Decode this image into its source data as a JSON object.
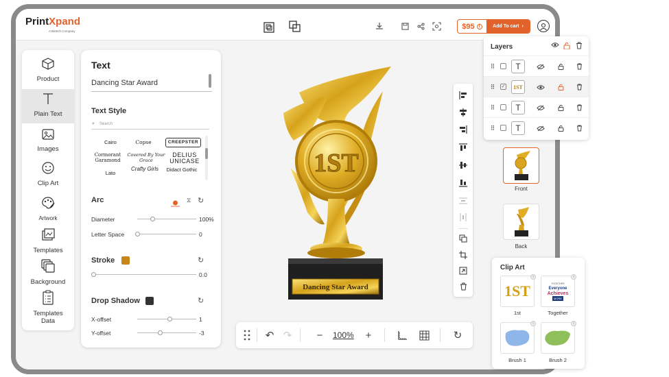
{
  "brand": {
    "name_part1": "Print",
    "name_part2": "Xpand",
    "tagline": "A Birtech Company"
  },
  "header": {
    "price": "$95",
    "add_to_cart": "Add To cart"
  },
  "sidebar": {
    "items": [
      {
        "label": "Product",
        "icon": "cube-icon"
      },
      {
        "label": "Plain Text",
        "icon": "text-t-icon"
      },
      {
        "label": "Images",
        "icon": "image-icon"
      },
      {
        "label": "Clip Art",
        "icon": "smiley-icon"
      },
      {
        "label": "Artwork",
        "icon": "palette-icon"
      },
      {
        "label": "Templates",
        "icon": "templates-icon"
      },
      {
        "label": "Background",
        "icon": "background-layers-icon"
      },
      {
        "label": "Templates Data",
        "icon": "clipboard-list-icon"
      }
    ],
    "active": "Plain Text"
  },
  "text_panel": {
    "title": "Text",
    "text_value": "Dancing Star Award",
    "text_style_heading": "Text Style",
    "search_placeholder": "Search",
    "fonts": [
      "Cairo",
      "Copse",
      "CREEPSTER",
      "Cormorant Garamond",
      "Covered By Your Grace",
      "DELIUS UNICASE",
      "Lato",
      "Crafty Girls",
      "Didact Gothic"
    ],
    "selected_font": "CREEPSTER",
    "arc": {
      "heading": "Arc",
      "diameter_label": "Diameter",
      "diameter_value": "100%",
      "letter_space_label": "Letter Space",
      "letter_space_value": "0"
    },
    "stroke": {
      "heading": "Stroke",
      "color": "#c8861a",
      "value": "0.0"
    },
    "drop_shadow": {
      "heading": "Drop Shadow",
      "color": "#333333",
      "x_offset_label": "X-offset",
      "x_offset_value": "1",
      "y_offset_label": "Y-offset",
      "y_offset_value": "-3"
    }
  },
  "stage": {
    "trophy_text": "1ST",
    "plaque_text": "Dancing Star Award"
  },
  "bottom_toolbar": {
    "zoom": "100%"
  },
  "layers": {
    "title": "Layers",
    "rows": [
      {
        "thumb": "T",
        "type": "text",
        "selected": false,
        "locked": false
      },
      {
        "thumb": "1ST",
        "type": "image",
        "selected": true,
        "locked": true
      },
      {
        "thumb": "T",
        "type": "text",
        "selected": false,
        "locked": false
      },
      {
        "thumb": "T",
        "type": "text",
        "selected": false,
        "locked": false
      }
    ]
  },
  "views": [
    {
      "label": "Front"
    },
    {
      "label": "Back"
    }
  ],
  "clip_art": {
    "title": "Clip Art",
    "items": [
      {
        "label": "1st",
        "text": "1ST"
      },
      {
        "label": "Together",
        "text_line1": "TOGETHER",
        "text_line2": "Everyone",
        "text_line3": "Achieves",
        "text_line4": "MORE"
      },
      {
        "label": "Brush 1",
        "color": "#8fb6e8"
      },
      {
        "label": "Brush 2",
        "color": "#8fbf5a"
      }
    ]
  },
  "colors": {
    "accent": "#e2622b",
    "gold": "#d4a017"
  }
}
